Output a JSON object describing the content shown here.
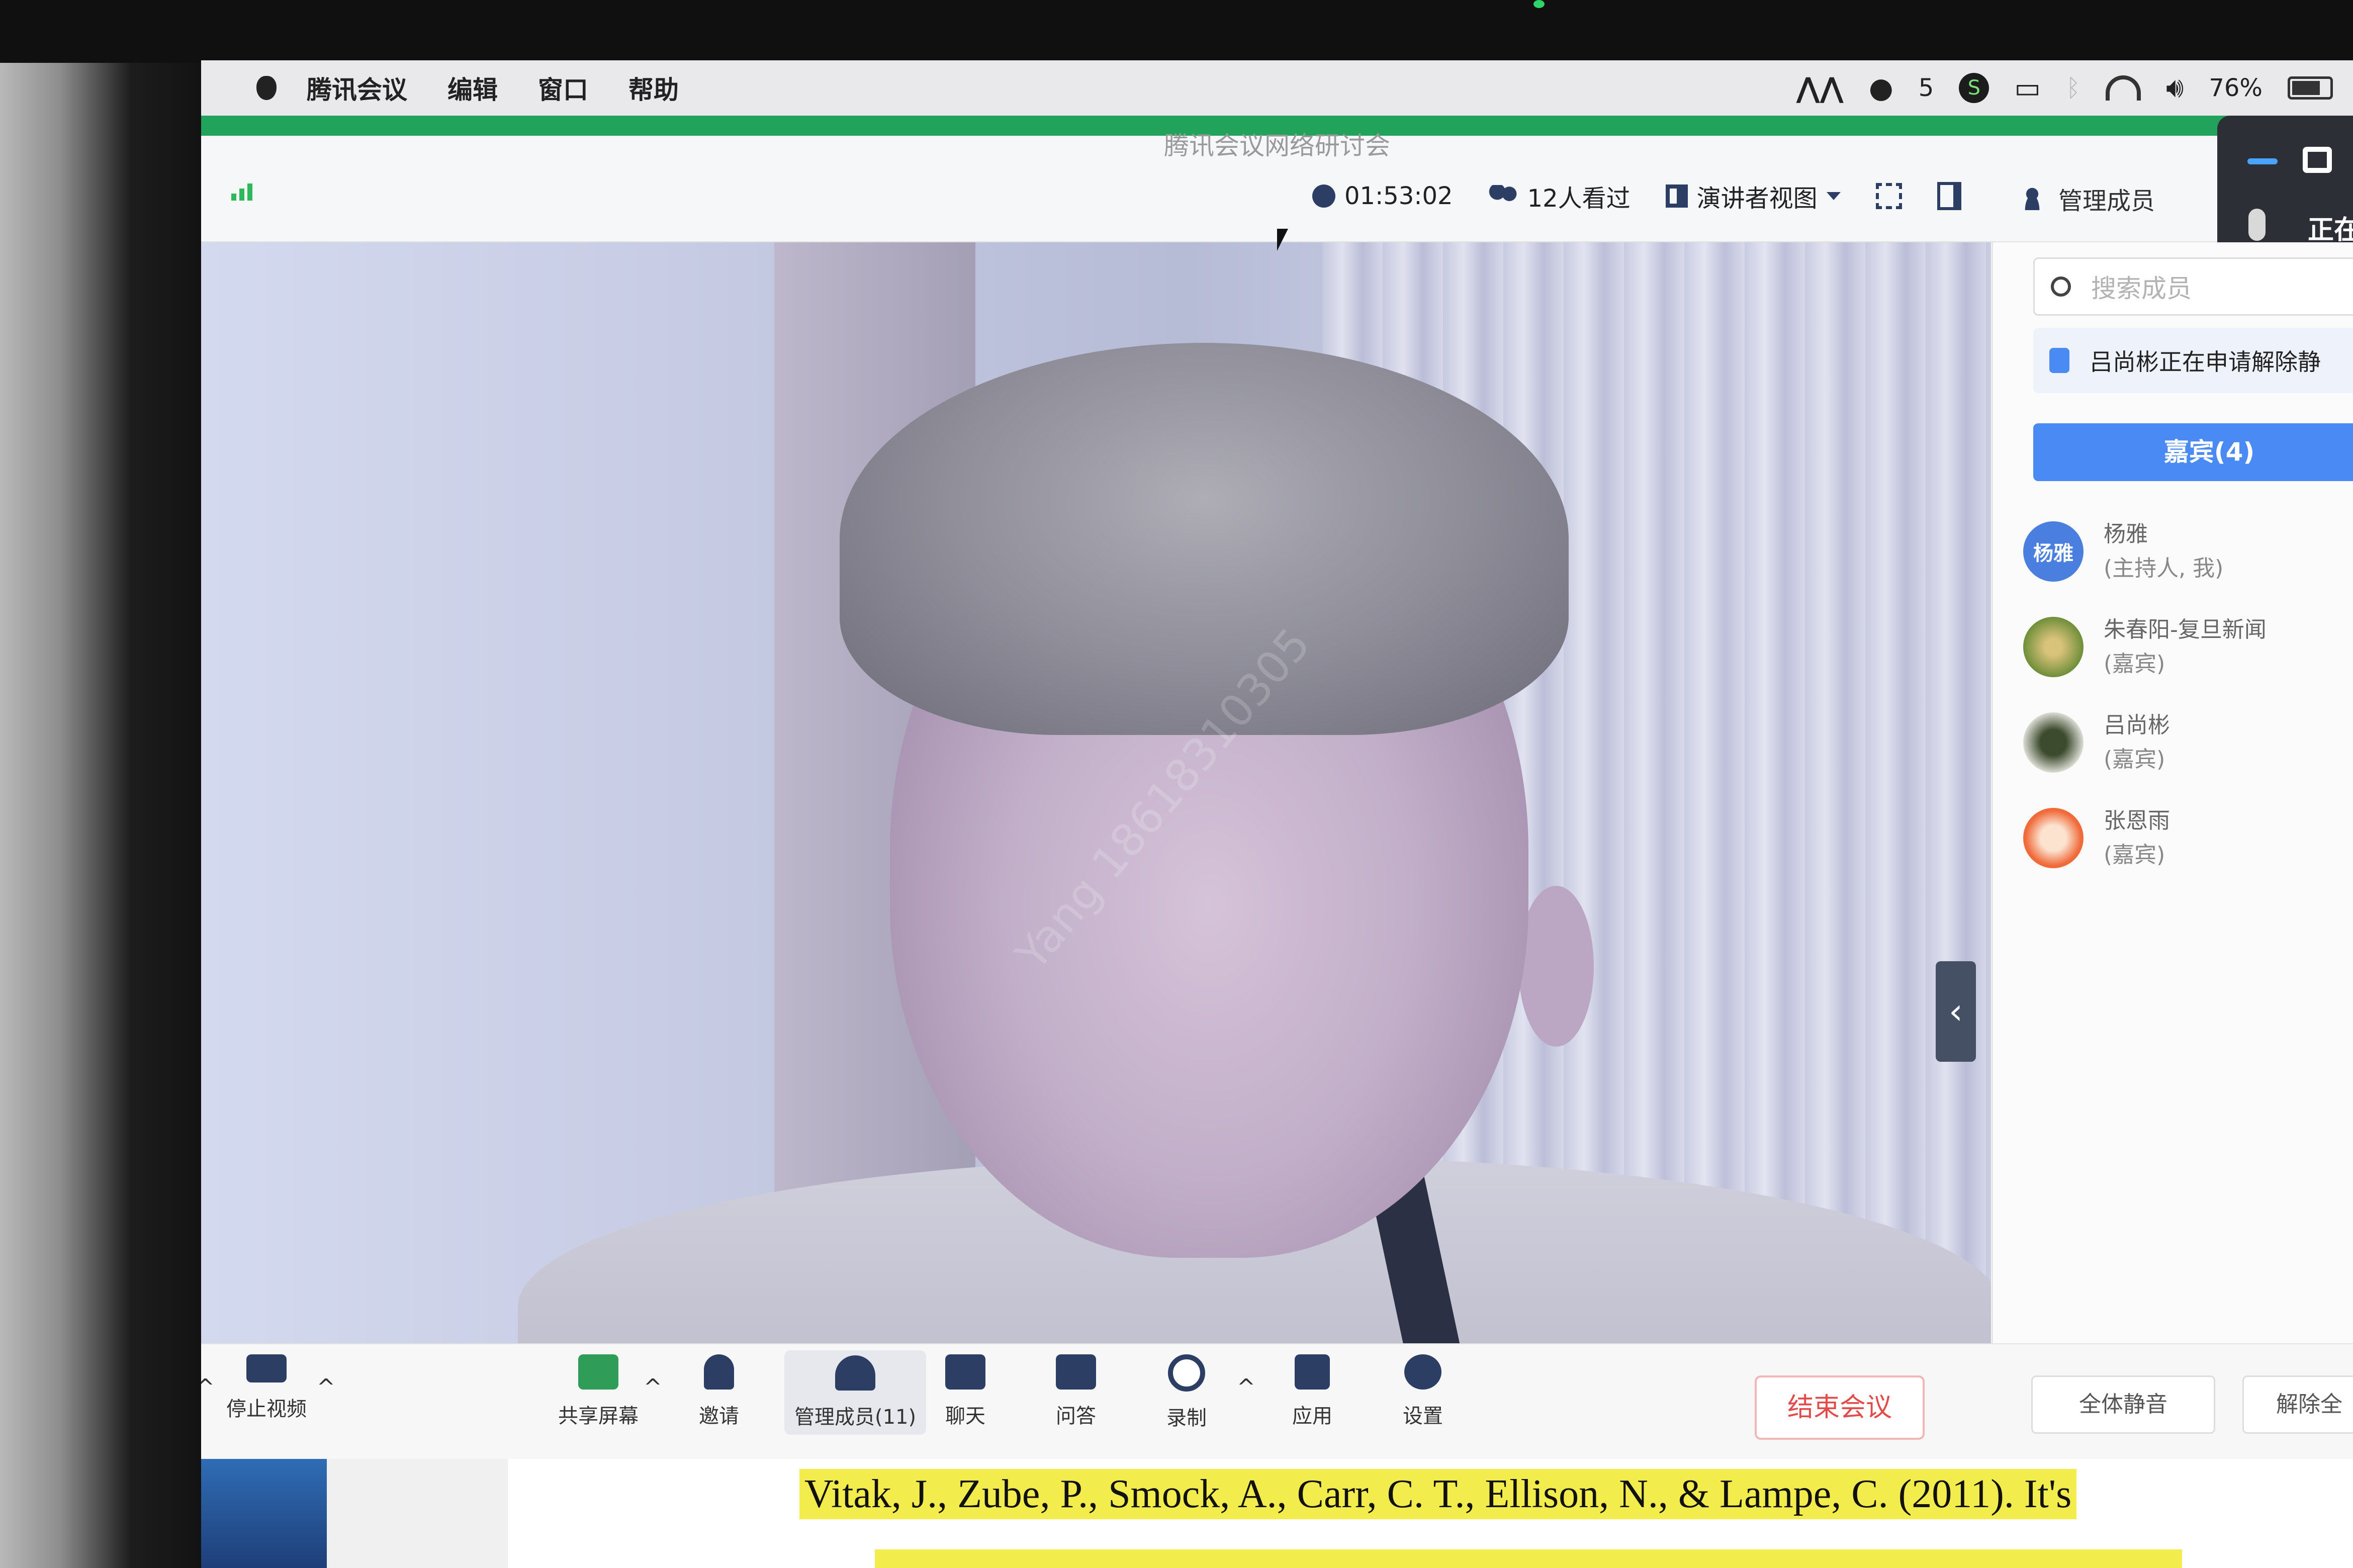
{
  "menubar": {
    "app_name": "腾讯会议",
    "items": [
      "编辑",
      "窗口",
      "帮助"
    ],
    "wechat_count": "5",
    "battery": "76%"
  },
  "meeting": {
    "title": "腾讯会议网络研讨会",
    "duration": "01:53:02",
    "viewers": "12人看过",
    "view_mode": "演讲者视图",
    "manage_members": "管理成员",
    "speaking_indicator": "正在"
  },
  "video": {
    "watermark": "Yang 18618310305"
  },
  "panel": {
    "search_placeholder": "搜索成员",
    "notice": "吕尚彬正在申请解除静",
    "guests_tab": "嘉宾(4)",
    "members": [
      {
        "name": "杨雅",
        "role": "(主持人, 我)",
        "avatar_text": "杨雅",
        "color": "#4a7fe0"
      },
      {
        "name": "朱春阳-复旦新闻",
        "role": "(嘉宾)",
        "avatar_text": "",
        "color": "#c6a24f"
      },
      {
        "name": "吕尚彬",
        "role": "(嘉宾)",
        "avatar_text": "",
        "color": "#6e7d5a"
      },
      {
        "name": "张恩雨",
        "role": "(嘉宾)",
        "avatar_text": "",
        "color": "#f06a3a"
      }
    ]
  },
  "toolbar": {
    "stop_video": "停止视频",
    "share_screen": "共享屏幕",
    "invite": "邀请",
    "manage_members": "管理成员(11)",
    "chat": "聊天",
    "qa": "问答",
    "record": "录制",
    "apps": "应用",
    "settings": "设置",
    "end_meeting": "结束会议",
    "mute_all": "全体静音",
    "unmute_all": "解除全"
  },
  "document": {
    "reference_text": "Vitak, J., Zube, P., Smock, A., Carr, C. T., Ellison, N., & Lampe, C. (2011). It's"
  }
}
